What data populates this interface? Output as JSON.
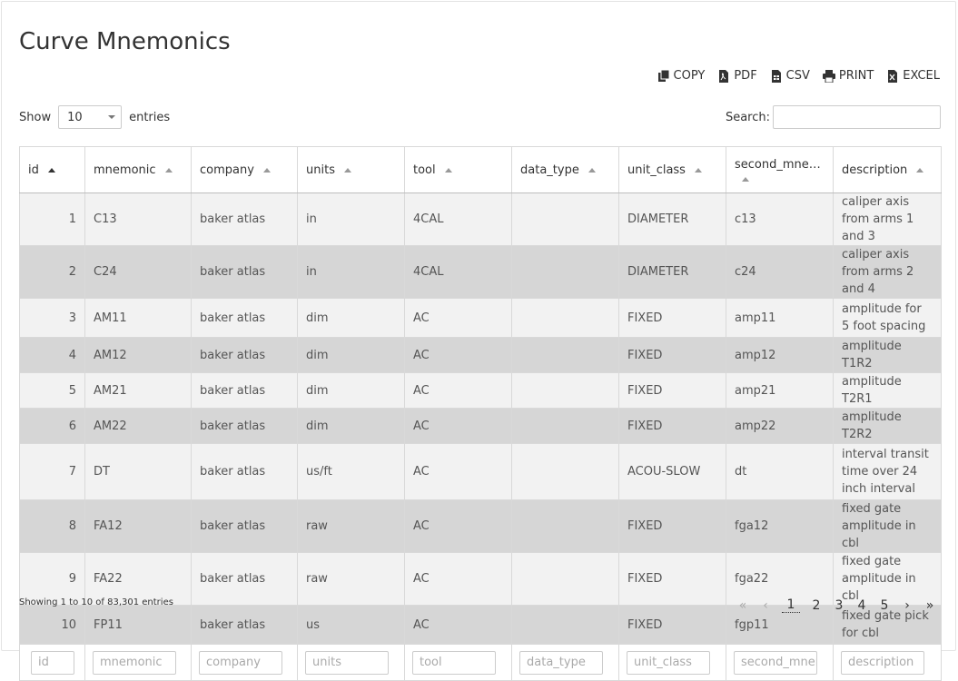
{
  "page": {
    "title": "Curve Mnemonics"
  },
  "export": {
    "copy": "COPY",
    "pdf": "PDF",
    "csv": "CSV",
    "print": "PRINT",
    "excel": "EXCEL"
  },
  "length": {
    "show": "Show",
    "value": "10",
    "entries": "entries"
  },
  "search": {
    "label": "Search:",
    "value": ""
  },
  "table": {
    "headers": [
      "id",
      "mnemonic",
      "company",
      "units",
      "tool",
      "data_type",
      "unit_class",
      "second_mnem...",
      "description"
    ],
    "rows": [
      {
        "id": "1",
        "mnemonic": "C13",
        "company": "baker atlas",
        "units": "in",
        "tool": "4CAL",
        "data_type": "",
        "unit_class": "DIAMETER",
        "second_mnemonic": "c13",
        "description": "caliper axis from arms 1 and 3"
      },
      {
        "id": "2",
        "mnemonic": "C24",
        "company": "baker atlas",
        "units": "in",
        "tool": "4CAL",
        "data_type": "",
        "unit_class": "DIAMETER",
        "second_mnemonic": "c24",
        "description": "caliper axis from arms 2 and 4"
      },
      {
        "id": "3",
        "mnemonic": "AM11",
        "company": "baker atlas",
        "units": "dim",
        "tool": "AC",
        "data_type": "",
        "unit_class": "FIXED",
        "second_mnemonic": "amp11",
        "description": "amplitude for 5 foot spacing"
      },
      {
        "id": "4",
        "mnemonic": "AM12",
        "company": "baker atlas",
        "units": "dim",
        "tool": "AC",
        "data_type": "",
        "unit_class": "FIXED",
        "second_mnemonic": "amp12",
        "description": "amplitude T1R2"
      },
      {
        "id": "5",
        "mnemonic": "AM21",
        "company": "baker atlas",
        "units": "dim",
        "tool": "AC",
        "data_type": "",
        "unit_class": "FIXED",
        "second_mnemonic": "amp21",
        "description": "amplitude T2R1"
      },
      {
        "id": "6",
        "mnemonic": "AM22",
        "company": "baker atlas",
        "units": "dim",
        "tool": "AC",
        "data_type": "",
        "unit_class": "FIXED",
        "second_mnemonic": "amp22",
        "description": "amplitude T2R2"
      },
      {
        "id": "7",
        "mnemonic": "DT",
        "company": "baker atlas",
        "units": "us/ft",
        "tool": "AC",
        "data_type": "",
        "unit_class": "ACOU-SLOW",
        "second_mnemonic": "dt",
        "description": "interval transit time over 24 inch interval"
      },
      {
        "id": "8",
        "mnemonic": "FA12",
        "company": "baker atlas",
        "units": "raw",
        "tool": "AC",
        "data_type": "",
        "unit_class": "FIXED",
        "second_mnemonic": "fga12",
        "description": "fixed gate amplitude in cbl"
      },
      {
        "id": "9",
        "mnemonic": "FA22",
        "company": "baker atlas",
        "units": "raw",
        "tool": "AC",
        "data_type": "",
        "unit_class": "FIXED",
        "second_mnemonic": "fga22",
        "description": "fixed gate amplitude in cbl"
      },
      {
        "id": "10",
        "mnemonic": "FP11",
        "company": "baker atlas",
        "units": "us",
        "tool": "AC",
        "data_type": "",
        "unit_class": "FIXED",
        "second_mnemonic": "fgp11",
        "description": "fixed gate pick for cbl"
      }
    ],
    "filters": [
      "id",
      "mnemonic",
      "company",
      "units",
      "tool",
      "data_type",
      "unit_class",
      "second_mner",
      "description"
    ]
  },
  "footer": {
    "info": "Showing 1 to 10 of 83,301 entries",
    "pages": [
      "1",
      "2",
      "3",
      "4",
      "5"
    ],
    "current_page": "1"
  },
  "icons": [
    "copy-icon",
    "pdf-icon",
    "csv-icon",
    "print-icon",
    "excel-icon"
  ]
}
